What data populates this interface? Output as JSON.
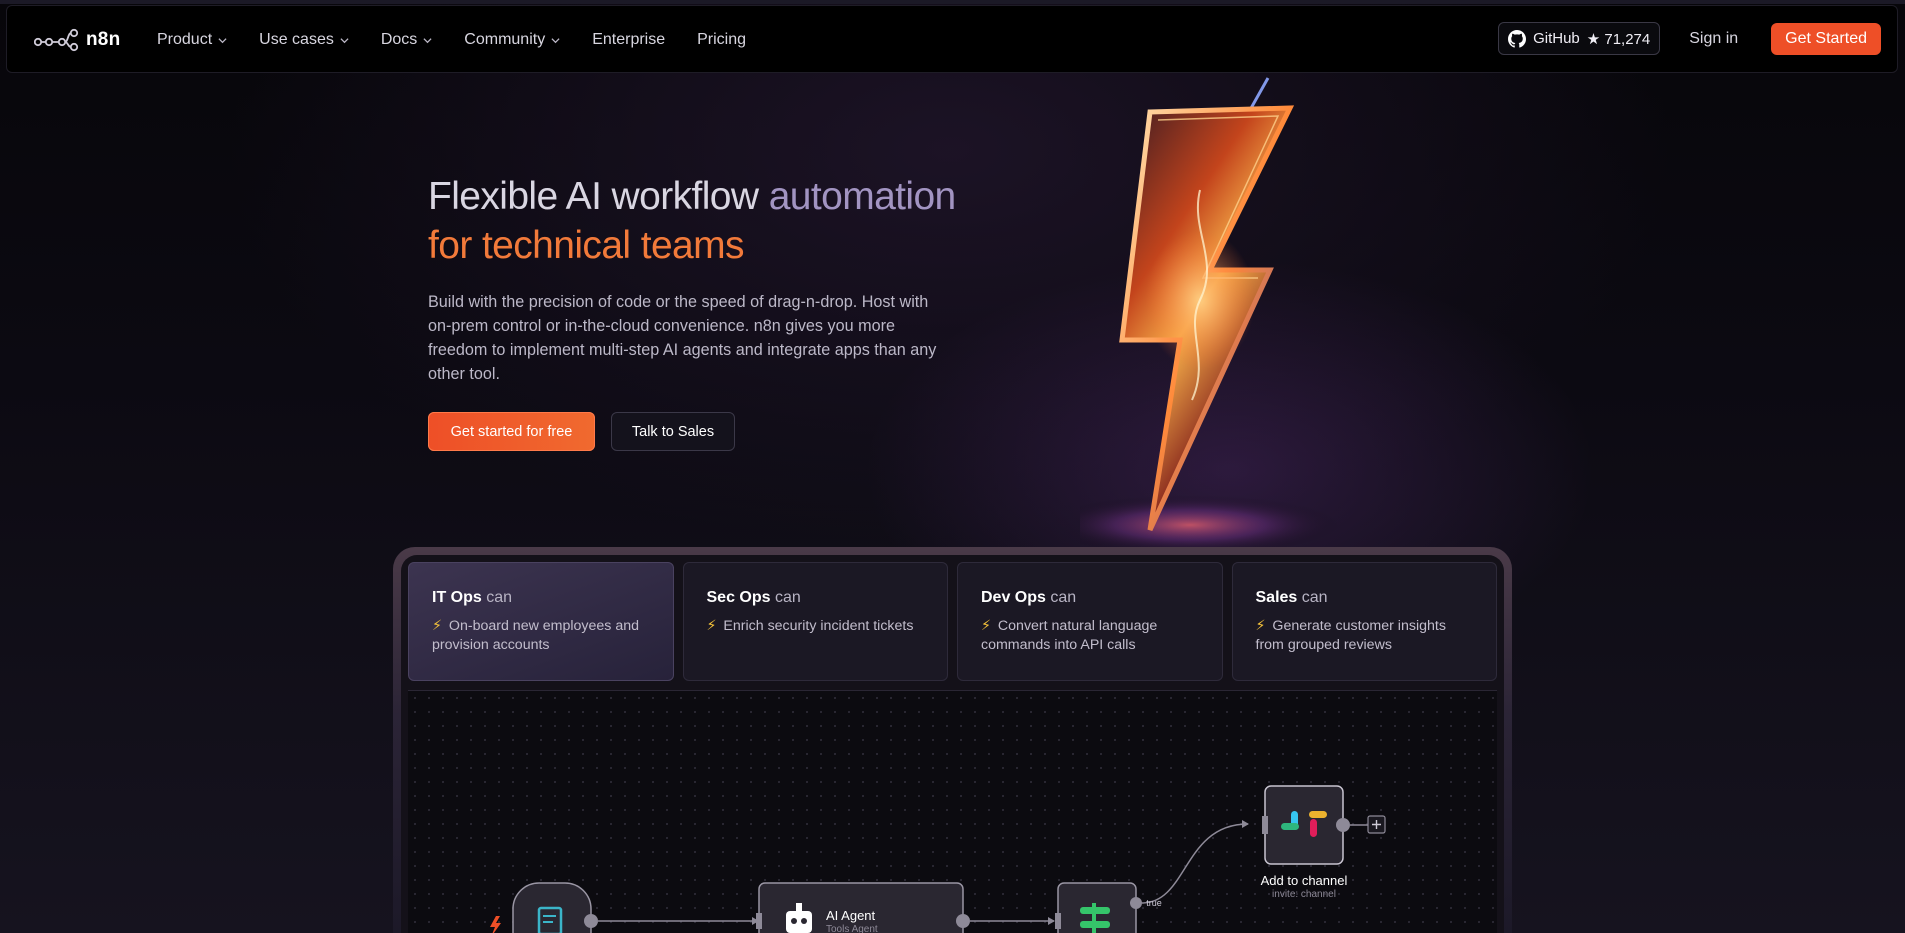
{
  "nav": {
    "logo_text": "n8n",
    "items": [
      {
        "label": "Product",
        "has_dropdown": true
      },
      {
        "label": "Use cases",
        "has_dropdown": true
      },
      {
        "label": "Docs",
        "has_dropdown": true
      },
      {
        "label": "Community",
        "has_dropdown": true
      },
      {
        "label": "Enterprise",
        "has_dropdown": false
      },
      {
        "label": "Pricing",
        "has_dropdown": false
      }
    ],
    "github_label": "GitHub",
    "github_stars": "★ 71,274",
    "signin_label": "Sign in",
    "get_started_label": "Get Started"
  },
  "hero": {
    "title_part1": "Flexible AI workflow ",
    "title_part2": "automation",
    "title_part3": "for technical teams",
    "description": "Build with the precision of code or the speed of drag-n-drop. Host with on-prem control or in-the-cloud convenience. n8n gives you more freedom to implement multi-step AI agents and integrate apps than any other tool.",
    "primary_cta": "Get started for free",
    "secondary_cta": "Talk to Sales"
  },
  "tabs": [
    {
      "team": "IT Ops",
      "can": "can",
      "bolt": "⚡",
      "desc": "On-board new employees and provision accounts",
      "active": true
    },
    {
      "team": "Sec Ops",
      "can": "can",
      "bolt": "⚡",
      "desc": "Enrich security incident tickets",
      "active": false
    },
    {
      "team": "Dev Ops",
      "can": "can",
      "bolt": "⚡",
      "desc": "Convert natural language commands into API calls",
      "active": false
    },
    {
      "team": "Sales",
      "can": "can",
      "bolt": "⚡",
      "desc": "Generate customer insights from grouped reviews",
      "active": false
    }
  ],
  "workflow": {
    "agent_title": "AI Agent",
    "agent_subtitle": "Tools Agent",
    "branch_true": "true",
    "slack_title": "Add to channel",
    "slack_subtitle": "invite: channel",
    "add_symbol": "+"
  },
  "colors": {
    "accent": "#ee4f27",
    "title_gray": "#d9d6e2",
    "title_purple": "#a294c2",
    "title_orange": "#f27a3a"
  }
}
